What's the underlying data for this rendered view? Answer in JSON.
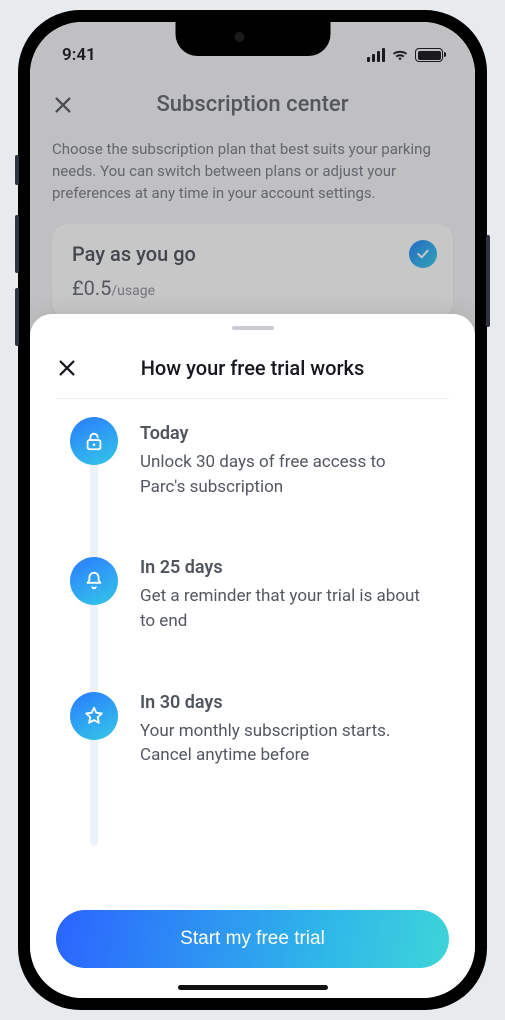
{
  "status": {
    "time": "9:41"
  },
  "page": {
    "title": "Subscription center",
    "subtitle": "Choose the subscription plan that best suits your parking needs. You can switch between plans or adjust your preferences at any time in your account settings."
  },
  "plan": {
    "title": "Pay as you go",
    "price": "£0.5",
    "unit": "/usage"
  },
  "sheet": {
    "title": "How your free trial works",
    "steps": [
      {
        "label": "Today",
        "text": "Unlock 30 days of free access to Parc's subscription"
      },
      {
        "label": "In 25 days",
        "text": "Get a reminder that your trial is about to end"
      },
      {
        "label": "In 30 days",
        "text": "Your monthly subscription starts. Cancel anytime before"
      }
    ],
    "cta": "Start my free trial"
  }
}
